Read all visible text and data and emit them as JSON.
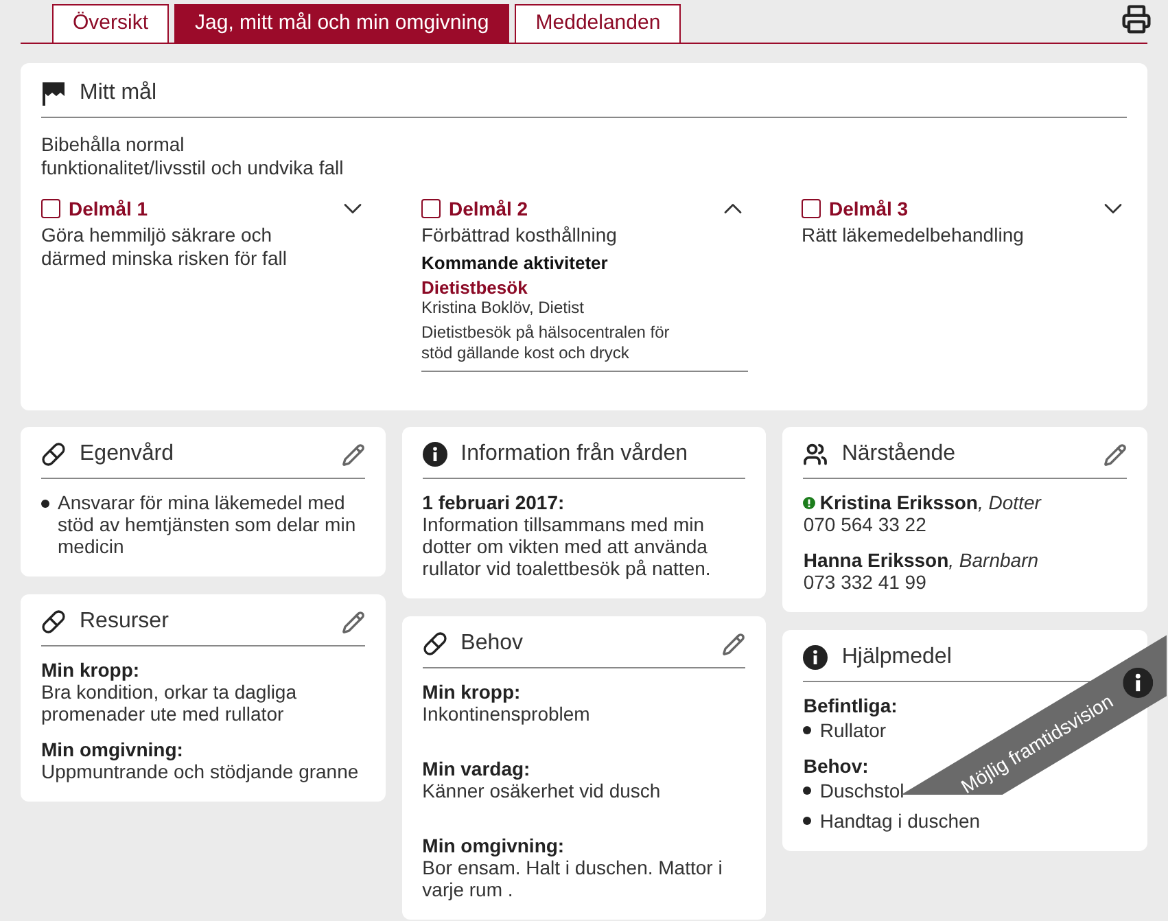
{
  "tabs": [
    {
      "label": "Översikt",
      "selected": false
    },
    {
      "label": "Jag, mitt mål och min omgivning",
      "selected": true
    },
    {
      "label": "Meddelanden",
      "selected": false
    }
  ],
  "goal": {
    "title": "Mitt mål",
    "description": "Bibehålla normal\nfunktionalitet/livsstil och undvika fall",
    "subgoals": [
      {
        "label": "Delmål 1",
        "text": "Göra hemmiljö säkrare och\ndärmed minska risken för fall",
        "checked": false,
        "expanded": false
      },
      {
        "label": "Delmål 2",
        "text": "Förbättrad kosthållning",
        "checked": false,
        "expanded": true,
        "activities_heading": "Kommande aktiviteter",
        "activities": [
          {
            "title": "Dietistbesök",
            "person": "Kristina Boklöv, Dietist",
            "description": "Dietistbesök på hälsocentralen för\nstöd gällande kost och dryck"
          }
        ]
      },
      {
        "label": "Delmål 3",
        "text": "Rätt läkemedelbehandling",
        "checked": false,
        "expanded": false
      }
    ]
  },
  "columns": [
    [
      {
        "title": "Egenvård",
        "editable": true,
        "kind": "list",
        "items": [
          "Ansvarar för mina läkemedel med stöd av hemtjänsten som delar min medicin"
        ]
      },
      {
        "title": "Resurser",
        "editable": true,
        "kind": "sections",
        "sections": [
          {
            "heading": "Min kropp:",
            "text": "Bra kondition, orkar ta dagliga promenader ute med rullator"
          },
          {
            "heading": "Min omgivning:",
            "text": "Uppmuntrande och stödjande granne"
          }
        ]
      }
    ],
    [
      {
        "title": "Information från vården",
        "editable": false,
        "kind": "sections",
        "sections": [
          {
            "heading": "1 februari 2017:",
            "text": "Information tillsammans med min dotter om vikten med att använda rullator vid toalettbesök på natten."
          }
        ]
      },
      {
        "title": "Behov",
        "editable": true,
        "kind": "sections",
        "spaced": true,
        "sections": [
          {
            "heading": "Min kropp:",
            "text": "Inkontinensproblem"
          },
          {
            "heading": "Min vardag:",
            "text": "Känner osäkerhet vid dusch"
          },
          {
            "heading": "Min omgivning:",
            "text": "Bor ensam. Halt i duschen. Mattor i varje rum ."
          }
        ]
      }
    ],
    [
      {
        "title": "Närstående",
        "editable": true,
        "kind": "contacts",
        "contacts": [
          {
            "name": "Kristina Eriksson",
            "relation": ", Dotter",
            "phone": "070 564 33 22",
            "alert": true
          },
          {
            "name": "Hanna Eriksson",
            "relation": ", Barnbarn",
            "phone": "073 332 41 99",
            "alert": false
          }
        ]
      },
      {
        "title": "Hjälpmedel",
        "editable": false,
        "kind": "sections",
        "sections": [
          {
            "heading": "Befintliga:",
            "items": [
              "Rullator"
            ]
          },
          {
            "heading": "Behov:",
            "items": [
              "Duschstol",
              "Handtag i duschen"
            ]
          }
        ]
      }
    ]
  ],
  "ribbon": {
    "text": "Möjlig framtidsvision"
  }
}
